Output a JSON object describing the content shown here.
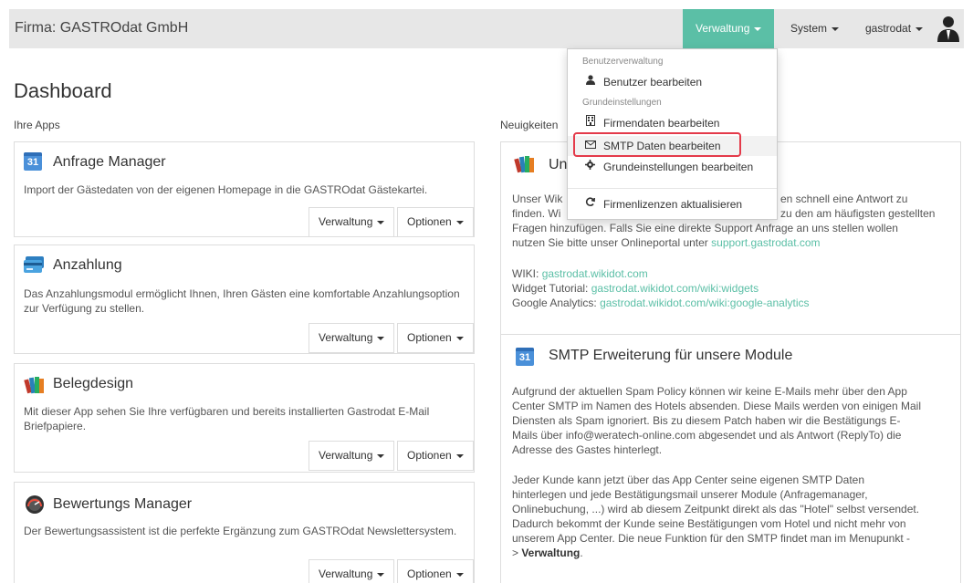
{
  "navbar": {
    "brand": "Firma: GASTROdat GmbH",
    "menus": {
      "verwaltung": "Verwaltung",
      "system": "System",
      "user": "gastrodat"
    }
  },
  "dropdown": {
    "header_users": "Benutzerverwaltung",
    "edit_users": "Benutzer bearbeiten",
    "header_settings": "Grundeinstellungen",
    "company_data": "Firmendaten bearbeiten",
    "smtp": "SMTP Daten bearbeiten",
    "basic_settings": "Grundeinstellungen bearbeiten",
    "licenses": "Firmenlizenzen aktualisieren"
  },
  "page": {
    "title": "Dashboard",
    "apps_label": "Ihre Apps",
    "news_label": "Neuigkeiten"
  },
  "buttons": {
    "verwaltung": "Verwaltung",
    "optionen": "Optionen"
  },
  "apps": [
    {
      "name": "Anfrage Manager",
      "icon": "calendar-icon",
      "desc": "Import der Gästedaten von der eigenen Homepage in die GASTROdat Gästekartei."
    },
    {
      "name": "Anzahlung",
      "icon": "credit-card-icon",
      "desc": "Das Anzahlungsmodul ermöglicht Ihnen, Ihren Gästen eine komfortable Anzahlungsoption zur Verfügung zu stellen."
    },
    {
      "name": "Belegdesign",
      "icon": "books-icon",
      "desc": "Mit dieser App sehen Sie Ihre verfügbaren und bereits installierten Gastrodat E-Mail Briefpapiere."
    },
    {
      "name": "Bewertungs Manager",
      "icon": "speedometer-icon",
      "desc": "Der Bewertungsassistent ist die perfekte Ergänzung zum GASTROdat Newslettersystem."
    }
  ],
  "news": [
    {
      "title_visible": "Un",
      "p1_col1": "Unser Wik",
      "p1_col1b": "finden. Wi",
      "p1_col2a": "en schnell eine Antwort zu",
      "p1_col2b": "zu den am häufigsten gestellten",
      "p1_line3": "Fragen hinzufügen. Falls Sie eine direkte Support Anfrage an uns stellen wollen",
      "p1_line4": "nutzen Sie bitte unser Onlineportal unter",
      "support_link": "support.gastrodat.com",
      "wiki_label": "WIKI:",
      "wiki_link": "gastrodat.wikidot.com",
      "widget_label": "Widget Tutorial:",
      "widget_link": "gastrodat.wikidot.com/wiki:widgets",
      "ga_label": "Google Analytics:",
      "ga_link": "gastrodat.wikidot.com/wiki:google-analytics"
    },
    {
      "title": "SMTP Erweiterung für unsere Module",
      "p1": [
        "Aufgrund der aktuellen Spam Policy können wir keine E-Mails mehr über den App",
        "Center SMTP im Namen des Hotels absenden. Diese Mails werden von einigen Mail",
        "Diensten als Spam ignoriert. Bis zu diesem Patch haben wir die Bestätigungs E-",
        "Mails über info@weratech-online.com abgesendet und als Antwort (ReplyTo) die",
        "Adresse des Gastes hinterlegt."
      ],
      "p2": [
        "Jeder Kunde kann jetzt über das App Center seine eigenen SMTP Daten",
        "hinterlegen und jede Bestätigungsmail unserer Module (Anfragemanager,",
        "Onlinebuchung, ...) wird ab diesem Zeitpunkt direkt als das \"Hotel\" selbst versendet.",
        "Dadurch bekommt der Kunde seine Bestätigungen vom Hotel und nicht mehr von",
        "unserem App Center. Die neue Funktion für den SMTP findet man im Menupunkt -"
      ],
      "p2_last_prefix": "> ",
      "p2_last_bold": "Verwaltung",
      "p2_last_suffix": "."
    }
  ],
  "colors": {
    "accent": "#5bbfa6",
    "navbar": "#e7e7e7",
    "highlight": "#e43a4a"
  }
}
